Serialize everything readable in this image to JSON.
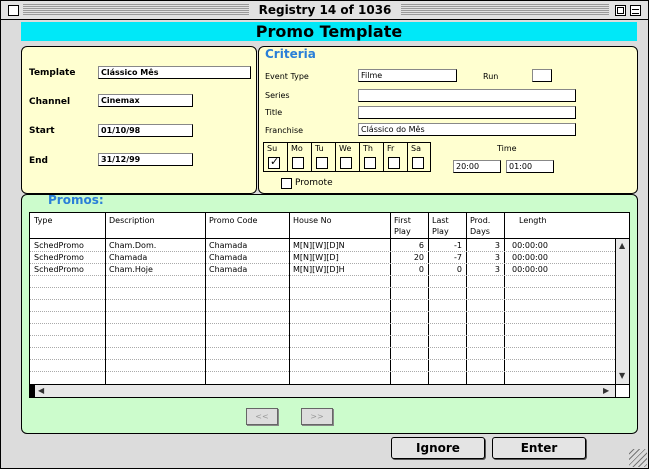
{
  "window": {
    "title": "Registry 14 of 1036"
  },
  "header": {
    "title": "Promo Template"
  },
  "template_panel": {
    "fields": [
      {
        "label": "Template",
        "value": "Clássico Mês"
      },
      {
        "label": "Channel",
        "value": "Cinemax"
      },
      {
        "label": "Start",
        "value": "01/10/98"
      },
      {
        "label": "End",
        "value": "31/12/99"
      }
    ]
  },
  "criteria": {
    "title": "Criteria",
    "event_type": {
      "label": "Event Type",
      "value": "Filme"
    },
    "run": {
      "label": "Run",
      "value": ""
    },
    "series": {
      "label": "Series",
      "value": ""
    },
    "title_field": {
      "label": "Title",
      "value": ""
    },
    "franchise": {
      "label": "Franchise",
      "value": "Clássico do Mês"
    },
    "days": [
      {
        "label": "Su",
        "checked": true
      },
      {
        "label": "Mo",
        "checked": false
      },
      {
        "label": "Tu",
        "checked": false
      },
      {
        "label": "We",
        "checked": false
      },
      {
        "label": "Th",
        "checked": false
      },
      {
        "label": "Fr",
        "checked": false
      },
      {
        "label": "Sa",
        "checked": false
      }
    ],
    "time": {
      "label": "Time",
      "from": "20:00",
      "to": "01:00"
    },
    "promote": {
      "label": "Promote",
      "checked": false
    }
  },
  "promos": {
    "title": "Promos:",
    "columns": [
      "Type",
      "Description",
      "Promo Code",
      "House No",
      "First\nPlay",
      "Last\nPlay",
      "Prod.\nDays",
      "Length"
    ],
    "rows": [
      [
        "SchedPromo",
        "Cham.Dom.",
        "Chamada",
        "M[N][W][D]N",
        "6",
        "-1",
        "3",
        "00:00:00"
      ],
      [
        "SchedPromo",
        "Chamada",
        "Chamada",
        "M[N][W][D]",
        "20",
        "-7",
        "3",
        "00:00:00"
      ],
      [
        "SchedPromo",
        "Cham.Hoje",
        "Chamada",
        "M[N][W][D]H",
        "0",
        "0",
        "3",
        "00:00:00"
      ]
    ]
  },
  "nav": {
    "prev": "<<",
    "next": ">>"
  },
  "buttons": {
    "ignore": "Ignore",
    "enter": "Enter"
  }
}
